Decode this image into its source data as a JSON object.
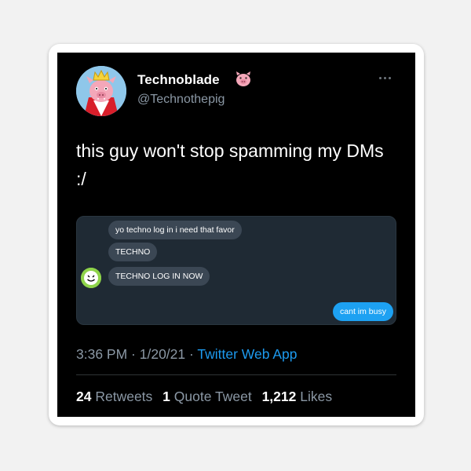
{
  "user": {
    "display_name": "Technoblade",
    "handle": "@Technothepig",
    "name_emoji": "pig-face-emoji",
    "avatar": "pig-with-crown-avatar"
  },
  "tweet": {
    "text": "this guy won't stop spamming my DMs :/"
  },
  "dm_screenshot": {
    "messages_received": [
      "yo techno log in i need that favor",
      "TECHNO",
      "TECHNO LOG IN NOW"
    ],
    "message_sent": "cant im busy",
    "sender_avatar": "smiley-face-avatar",
    "colors": {
      "received": "#3b4754",
      "sent": "#1da1f2",
      "background": "#1f2a34"
    }
  },
  "meta": {
    "time": "3:36 PM",
    "separator1": " · ",
    "date": "1/20/21",
    "separator2": " · ",
    "source": "Twitter Web App"
  },
  "stats": {
    "retweets_count": "24",
    "retweets_label": "Retweets",
    "quote_count": "1",
    "quote_label": "Quote Tweet",
    "likes_count": "1,212",
    "likes_label": "Likes"
  },
  "colors": {
    "background": "#000000",
    "text": "#ffffff",
    "secondary": "#8b98a5",
    "link": "#1d9bf0"
  }
}
